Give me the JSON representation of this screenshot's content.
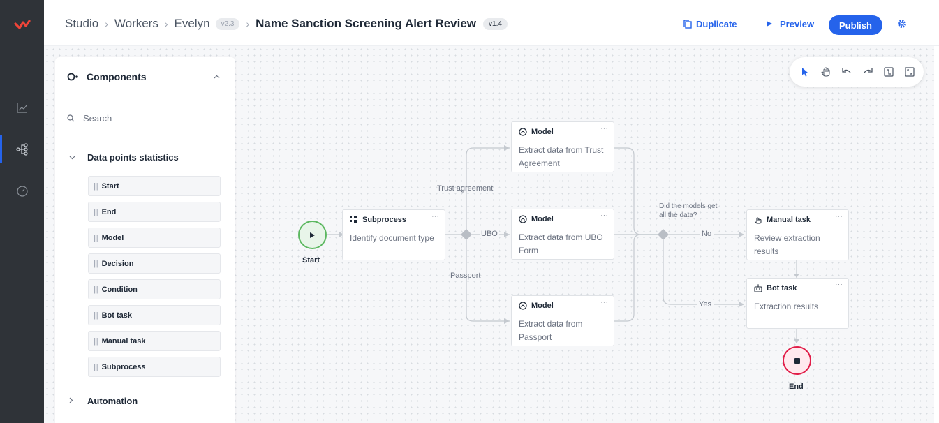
{
  "colors": {
    "accent": "#2563eb",
    "logo": "#f04438",
    "start": "#4caf50",
    "end": "#e11d48"
  },
  "rail": {
    "icons": [
      "logo-icon",
      "analytics-icon",
      "workflow-icon",
      "speedometer-icon"
    ]
  },
  "header": {
    "breadcrumb": [
      "Studio",
      "Workers",
      "Evelyn"
    ],
    "worker_version": "v2.3",
    "title": "Name Sanction Screening Alert Review",
    "version": "v1.4",
    "duplicate_label": "Duplicate",
    "preview_label": "Preview",
    "publish_label": "Publish"
  },
  "panel": {
    "title": "Components",
    "search_placeholder": "Search",
    "section_title": "Data points statistics",
    "items": [
      "Start",
      "End",
      "Model",
      "Decision",
      "Condition",
      "Bot task",
      "Manual task",
      "Subprocess"
    ],
    "section2_title": "Automation"
  },
  "toolbar": {
    "tools": [
      "pointer-icon",
      "hand-icon",
      "undo-icon",
      "redo-icon",
      "fit-icon",
      "fullscreen-icon"
    ]
  },
  "flow": {
    "start_label": "Start",
    "end_label": "End",
    "subprocess": {
      "type": "Subprocess",
      "desc": "Identify document type"
    },
    "model_trust": {
      "type": "Model",
      "desc": "Extract data from Trust Agreement"
    },
    "model_ubo": {
      "type": "Model",
      "desc": "Extract data from UBO Form"
    },
    "model_passport": {
      "type": "Model",
      "desc": "Extract data from Passport"
    },
    "manual_task": {
      "type": "Manual task",
      "desc": "Review extraction results"
    },
    "bot_task": {
      "type": "Bot task",
      "desc": "Extraction results"
    },
    "edge_labels": {
      "trust": "Trust agreement",
      "ubo": "UBO",
      "passport": "Passport",
      "question": "Did the models get all the data?",
      "no": "No",
      "yes": "Yes"
    },
    "more_label": "···"
  }
}
